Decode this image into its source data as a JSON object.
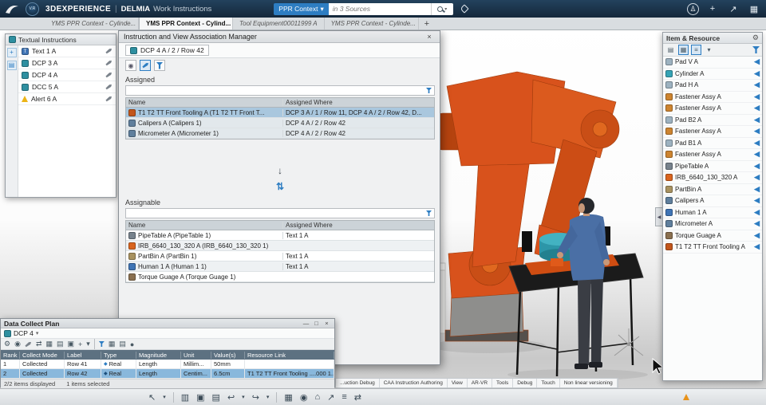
{
  "topbar": {
    "brand": "3DEXPERIENCE",
    "divider": "|",
    "app_name": "DELMIA",
    "app_desc": "Work Instructions",
    "compass_label": "V.R",
    "search_scope": "PPR Context",
    "search_placeholder": "in 3 Sources"
  },
  "tabbar": {
    "tabs": [
      {
        "label": "YMS PPR Context - Cylinde..."
      },
      {
        "label": "YMS PPR Context - Cylind..."
      },
      {
        "label": "Tool Equipment00011999 A"
      },
      {
        "label": "YMS PPR Context - Cylinde..."
      }
    ],
    "add_label": "+"
  },
  "textual": {
    "title": "Textual Instructions",
    "items": [
      {
        "label": "Text 1 A"
      },
      {
        "label": "DCP 3 A"
      },
      {
        "label": "DCP 4 A"
      },
      {
        "label": "DCC 5 A"
      },
      {
        "label": "Alert 6 A"
      }
    ]
  },
  "dialog": {
    "title": "Instruction and View Association Manager",
    "breadcrumb": "DCP 4 A / 2 / Row 42",
    "assigned": {
      "label": "Assigned",
      "columns": [
        "Name",
        "Assigned Where"
      ],
      "rows": [
        {
          "name": "T1 T2 TT Front Tooling A (T1 T2 TT Front T...",
          "where": "DCP 3 A / 1 / Row 11, DCP 4 A / 2 / Row 42, D..."
        },
        {
          "name": "Calipers A (Calipers 1)",
          "where": "DCP 4 A / 2 / Row 42"
        },
        {
          "name": "Micrometer A (Micrometer 1)",
          "where": "DCP 4 A / 2 / Row 42"
        }
      ]
    },
    "assignable": {
      "label": "Assignable",
      "columns": [
        "Name",
        "Assigned Where"
      ],
      "rows": [
        {
          "name": "PipeTable A (PipeTable 1)",
          "where": "Text 1 A"
        },
        {
          "name": "IRB_6640_130_320 A (IRB_6640_130_320 1)",
          "where": ""
        },
        {
          "name": "PartBin A (PartBin 1)",
          "where": "Text 1 A"
        },
        {
          "name": "Human 1 A (Human 1 1)",
          "where": "Text 1 A"
        },
        {
          "name": "Torque Guage A (Torque Guage 1)",
          "where": ""
        }
      ]
    }
  },
  "item_resource": {
    "title": "Item & Resource",
    "items": [
      "Pad V A",
      "Cylinder A",
      "Pad H A",
      "Fastener Assy A",
      "Fastener Assy A",
      "Pad B2 A",
      "Fastener Assy A",
      "Pad B1 A",
      "Fastener Assy A",
      "PipeTable A",
      "IRB_6640_130_320 A",
      "PartBin A",
      "Calipers A",
      "Human 1 A",
      "Micrometer A",
      "Torque Guage A",
      "T1 T2 TT Front Tooling A"
    ]
  },
  "dcp": {
    "title": "Data Collect Plan",
    "breadcrumb": "DCP 4",
    "columns": [
      "Rank",
      "Collect Mode",
      "Label",
      "Type",
      "Magnitude",
      "Unit",
      "Value(s)",
      "Resource Link"
    ],
    "rows": [
      [
        "1",
        "Collected",
        "Row 41",
        "Real",
        "Length",
        "Millim...",
        "50mm",
        ""
      ],
      [
        "2",
        "Collected",
        "Row 42",
        "Real",
        "Length",
        "Centim...",
        "6.5cm",
        "T1 T2 TT Front Tooling ....000 1..."
      ]
    ],
    "status_left": "2/2 items displayed",
    "status_right": "1 items selected"
  },
  "bottom_tabs": [
    "...uction Debug",
    "CAA Instruction Authoring",
    "View",
    "AR-VR",
    "Tools",
    "Debug",
    "Touch",
    "Non linear versioning"
  ],
  "icons": {
    "close": "×",
    "minimize": "—",
    "maximize": "□",
    "add": "+",
    "chevron_down": "▾",
    "gear": "⚙",
    "person": "♙",
    "left_arrow": "◀",
    "transfer_down": "↓",
    "transfer_swap": "⇅",
    "undo": "↩",
    "redo": "↪",
    "cursor": "↖",
    "table": "▦",
    "rows": "▤",
    "copy": "▣",
    "paste": "▥",
    "camera": "◉",
    "share": "↗",
    "list": "≡",
    "diamond": "◆",
    "text_t": "T",
    "swap_h": "⇄",
    "home": "⌂",
    "dot": "●"
  },
  "colors": {
    "accent_blue": "#2d7dc2",
    "robot_orange": "#d8521c",
    "selection_blue": "#a9c7de",
    "dcp_selection": "#89b8dc"
  }
}
